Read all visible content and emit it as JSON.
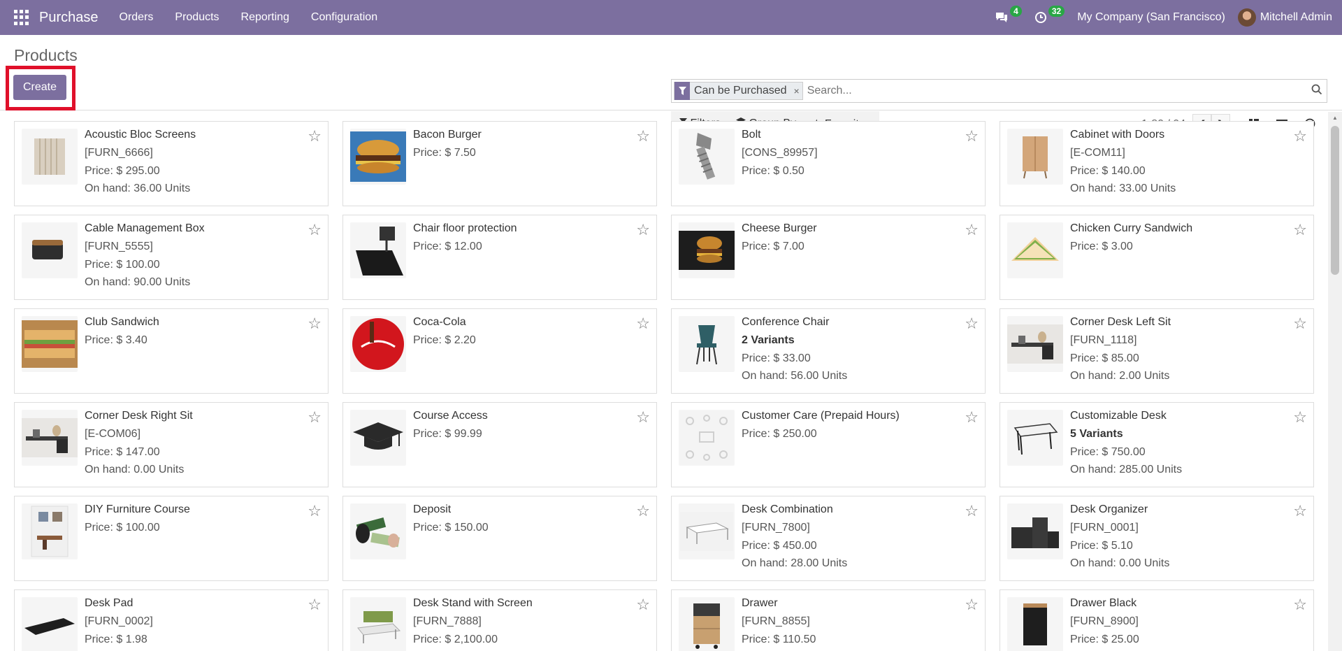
{
  "navbar": {
    "app_name": "Purchase",
    "menu": [
      "Orders",
      "Products",
      "Reporting",
      "Configuration"
    ],
    "messages_count": "4",
    "activities_count": "32",
    "company": "My Company (San Francisco)",
    "user": "Mitchell Admin"
  },
  "control": {
    "title": "Products",
    "create_label": "Create",
    "facet_label": "Can be Purchased",
    "facet_remove": "×",
    "search_placeholder": "Search...",
    "filters_label": "Filters",
    "groupby_label": "Group By",
    "favorites_label": "Favorites",
    "pager": "1-80 / 94"
  },
  "products": [
    {
      "name": "Acoustic Bloc Screens",
      "ref": "[FURN_6666]",
      "variants": "",
      "price": "Price: $ 295.00",
      "onhand": "On hand: 36.00 Units",
      "thumb": "screen"
    },
    {
      "name": "Bacon Burger",
      "ref": "",
      "variants": "",
      "price": "Price: $ 7.50",
      "onhand": "",
      "thumb": "burger"
    },
    {
      "name": "Bolt",
      "ref": "[CONS_89957]",
      "variants": "",
      "price": "Price: $ 0.50",
      "onhand": "",
      "thumb": "bolt"
    },
    {
      "name": "Cabinet with Doors",
      "ref": "[E-COM11]",
      "variants": "",
      "price": "Price: $ 140.00",
      "onhand": "On hand: 33.00 Units",
      "thumb": "cabinet"
    },
    {
      "name": "Cable Management Box",
      "ref": "[FURN_5555]",
      "variants": "",
      "price": "Price: $ 100.00",
      "onhand": "On hand: 90.00 Units",
      "thumb": "box"
    },
    {
      "name": "Chair floor protection",
      "ref": "",
      "variants": "",
      "price": "Price: $ 12.00",
      "onhand": "",
      "thumb": "mat"
    },
    {
      "name": "Cheese Burger",
      "ref": "",
      "variants": "",
      "price": "Price: $ 7.00",
      "onhand": "",
      "thumb": "burger-dark"
    },
    {
      "name": "Chicken Curry Sandwich",
      "ref": "",
      "variants": "",
      "price": "Price: $ 3.00",
      "onhand": "",
      "thumb": "sandwich"
    },
    {
      "name": "Club Sandwich",
      "ref": "",
      "variants": "",
      "price": "Price: $ 3.40",
      "onhand": "",
      "thumb": "club"
    },
    {
      "name": "Coca-Cola",
      "ref": "",
      "variants": "",
      "price": "Price: $ 2.20",
      "onhand": "",
      "thumb": "cola"
    },
    {
      "name": "Conference Chair",
      "ref": "",
      "variants": "2 Variants",
      "price": "Price: $ 33.00",
      "onhand": "On hand: 56.00 Units",
      "thumb": "chair"
    },
    {
      "name": "Corner Desk Left Sit",
      "ref": "[FURN_1118]",
      "variants": "",
      "price": "Price: $ 85.00",
      "onhand": "On hand: 2.00 Units",
      "thumb": "desk"
    },
    {
      "name": "Corner Desk Right Sit",
      "ref": "[E-COM06]",
      "variants": "",
      "price": "Price: $ 147.00",
      "onhand": "On hand: 0.00 Units",
      "thumb": "desk"
    },
    {
      "name": "Course Access",
      "ref": "",
      "variants": "",
      "price": "Price: $ 99.99",
      "onhand": "",
      "thumb": "cap"
    },
    {
      "name": "Customer Care (Prepaid Hours)",
      "ref": "",
      "variants": "",
      "price": "Price: $ 250.00",
      "onhand": "",
      "thumb": "care"
    },
    {
      "name": "Customizable Desk",
      "ref": "",
      "variants": "5 Variants",
      "price": "Price: $ 750.00",
      "onhand": "On hand: 285.00 Units",
      "thumb": "table"
    },
    {
      "name": "DIY Furniture Course",
      "ref": "",
      "variants": "",
      "price": "Price: $ 100.00",
      "onhand": "",
      "thumb": "room"
    },
    {
      "name": "Deposit",
      "ref": "",
      "variants": "",
      "price": "Price: $ 150.00",
      "onhand": "",
      "thumb": "money"
    },
    {
      "name": "Desk Combination",
      "ref": "[FURN_7800]",
      "variants": "",
      "price": "Price: $ 450.00",
      "onhand": "On hand: 28.00 Units",
      "thumb": "combo"
    },
    {
      "name": "Desk Organizer",
      "ref": "[FURN_0001]",
      "variants": "",
      "price": "Price: $ 5.10",
      "onhand": "On hand: 0.00 Units",
      "thumb": "organizer"
    },
    {
      "name": "Desk Pad",
      "ref": "[FURN_0002]",
      "variants": "",
      "price": "Price: $ 1.98",
      "onhand": "",
      "thumb": "pad"
    },
    {
      "name": "Desk Stand with Screen",
      "ref": "[FURN_7888]",
      "variants": "",
      "price": "Price: $ 2,100.00",
      "onhand": "",
      "thumb": "stand"
    },
    {
      "name": "Drawer",
      "ref": "[FURN_8855]",
      "variants": "",
      "price": "Price: $ 110.50",
      "onhand": "",
      "thumb": "drawer"
    },
    {
      "name": "Drawer Black",
      "ref": "[FURN_8900]",
      "variants": "",
      "price": "Price: $ 25.00",
      "onhand": "",
      "thumb": "drawer-black"
    }
  ]
}
